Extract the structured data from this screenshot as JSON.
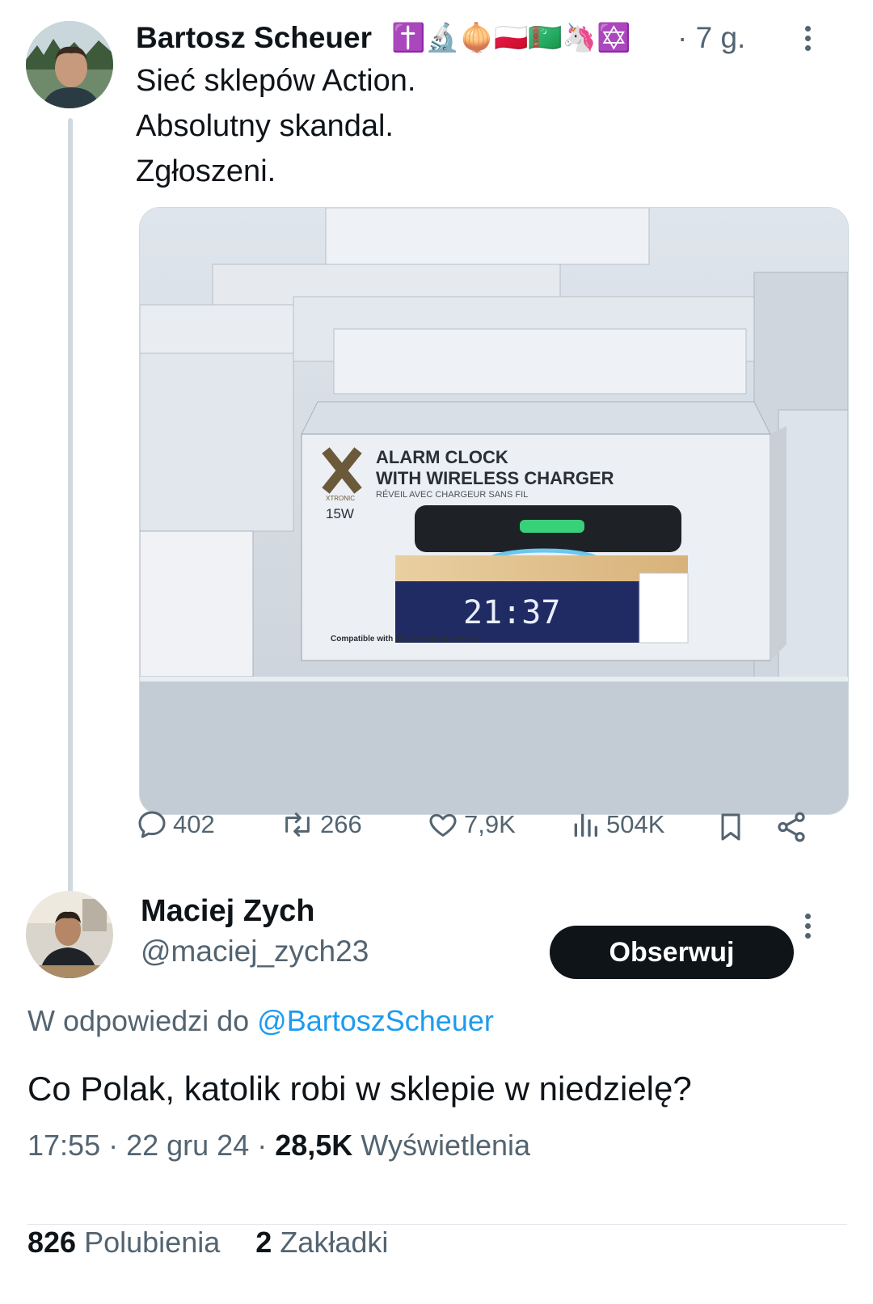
{
  "original_tweet": {
    "author_name": "Bartosz Scheuer",
    "author_emojis": "✝️🔬🧅🇵🇱🇹🇲🦄✡️",
    "separator": "·",
    "time": "7 g.",
    "text_lines": [
      "Sieć sklepów Action.",
      "Absolutny skandal.",
      "Zgłoszeni."
    ],
    "media": {
      "box_title_1": "ALARM CLOCK",
      "box_title_2": "WITH WIRELESS CHARGER",
      "box_subtitle": "RÉVEIL AVEC CHARGEUR SANS FIL",
      "brand": "XTRONIC",
      "power": "15W",
      "display_time": "21:37",
      "compat": "Compatible with all Qi enabled devices"
    },
    "stats": {
      "replies": "402",
      "reposts": "266",
      "likes": "7,9K",
      "views": "504K"
    }
  },
  "reply": {
    "author_name": "Maciej Zych",
    "handle": "@maciej_zych23",
    "follow_label": "Obserwuj",
    "in_reply_prefix": "W odpowiedzi do",
    "in_reply_handle": "@BartoszScheuer",
    "text": "Co Polak, katolik robi w sklepie w niedzielę?",
    "time": "17:55",
    "date": "22 gru 24",
    "views_count": "28,5K",
    "views_label": "Wyświetlenia",
    "likes_count": "826",
    "likes_label": "Polubienia",
    "bookmarks_count": "2",
    "bookmarks_label": "Zakładki"
  },
  "colors": {
    "text": "#0f1419",
    "muted": "#536471",
    "link": "#1d9bf0",
    "thread_line": "#cfd9de",
    "button_bg": "#0f1419"
  }
}
